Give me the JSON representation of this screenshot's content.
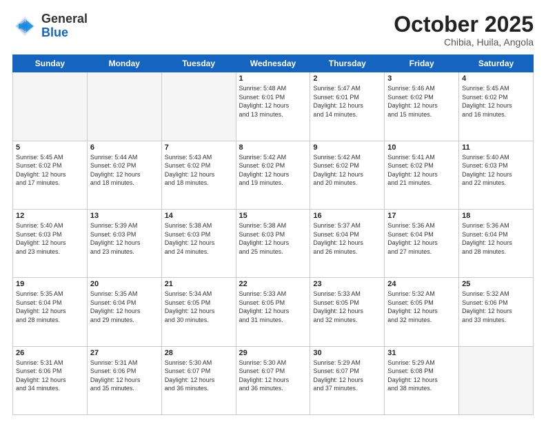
{
  "header": {
    "logo_line1": "General",
    "logo_line2": "Blue",
    "month": "October 2025",
    "location": "Chibia, Huila, Angola"
  },
  "weekdays": [
    "Sunday",
    "Monday",
    "Tuesday",
    "Wednesday",
    "Thursday",
    "Friday",
    "Saturday"
  ],
  "weeks": [
    [
      {
        "day": "",
        "info": "",
        "empty": true
      },
      {
        "day": "",
        "info": "",
        "empty": true
      },
      {
        "day": "",
        "info": "",
        "empty": true
      },
      {
        "day": "1",
        "info": "Sunrise: 5:48 AM\nSunset: 6:01 PM\nDaylight: 12 hours\nand 13 minutes."
      },
      {
        "day": "2",
        "info": "Sunrise: 5:47 AM\nSunset: 6:01 PM\nDaylight: 12 hours\nand 14 minutes."
      },
      {
        "day": "3",
        "info": "Sunrise: 5:46 AM\nSunset: 6:02 PM\nDaylight: 12 hours\nand 15 minutes."
      },
      {
        "day": "4",
        "info": "Sunrise: 5:45 AM\nSunset: 6:02 PM\nDaylight: 12 hours\nand 16 minutes."
      }
    ],
    [
      {
        "day": "5",
        "info": "Sunrise: 5:45 AM\nSunset: 6:02 PM\nDaylight: 12 hours\nand 17 minutes."
      },
      {
        "day": "6",
        "info": "Sunrise: 5:44 AM\nSunset: 6:02 PM\nDaylight: 12 hours\nand 18 minutes."
      },
      {
        "day": "7",
        "info": "Sunrise: 5:43 AM\nSunset: 6:02 PM\nDaylight: 12 hours\nand 18 minutes."
      },
      {
        "day": "8",
        "info": "Sunrise: 5:42 AM\nSunset: 6:02 PM\nDaylight: 12 hours\nand 19 minutes."
      },
      {
        "day": "9",
        "info": "Sunrise: 5:42 AM\nSunset: 6:02 PM\nDaylight: 12 hours\nand 20 minutes."
      },
      {
        "day": "10",
        "info": "Sunrise: 5:41 AM\nSunset: 6:02 PM\nDaylight: 12 hours\nand 21 minutes."
      },
      {
        "day": "11",
        "info": "Sunrise: 5:40 AM\nSunset: 6:03 PM\nDaylight: 12 hours\nand 22 minutes."
      }
    ],
    [
      {
        "day": "12",
        "info": "Sunrise: 5:40 AM\nSunset: 6:03 PM\nDaylight: 12 hours\nand 23 minutes."
      },
      {
        "day": "13",
        "info": "Sunrise: 5:39 AM\nSunset: 6:03 PM\nDaylight: 12 hours\nand 23 minutes."
      },
      {
        "day": "14",
        "info": "Sunrise: 5:38 AM\nSunset: 6:03 PM\nDaylight: 12 hours\nand 24 minutes."
      },
      {
        "day": "15",
        "info": "Sunrise: 5:38 AM\nSunset: 6:03 PM\nDaylight: 12 hours\nand 25 minutes."
      },
      {
        "day": "16",
        "info": "Sunrise: 5:37 AM\nSunset: 6:04 PM\nDaylight: 12 hours\nand 26 minutes."
      },
      {
        "day": "17",
        "info": "Sunrise: 5:36 AM\nSunset: 6:04 PM\nDaylight: 12 hours\nand 27 minutes."
      },
      {
        "day": "18",
        "info": "Sunrise: 5:36 AM\nSunset: 6:04 PM\nDaylight: 12 hours\nand 28 minutes."
      }
    ],
    [
      {
        "day": "19",
        "info": "Sunrise: 5:35 AM\nSunset: 6:04 PM\nDaylight: 12 hours\nand 28 minutes."
      },
      {
        "day": "20",
        "info": "Sunrise: 5:35 AM\nSunset: 6:04 PM\nDaylight: 12 hours\nand 29 minutes."
      },
      {
        "day": "21",
        "info": "Sunrise: 5:34 AM\nSunset: 6:05 PM\nDaylight: 12 hours\nand 30 minutes."
      },
      {
        "day": "22",
        "info": "Sunrise: 5:33 AM\nSunset: 6:05 PM\nDaylight: 12 hours\nand 31 minutes."
      },
      {
        "day": "23",
        "info": "Sunrise: 5:33 AM\nSunset: 6:05 PM\nDaylight: 12 hours\nand 32 minutes."
      },
      {
        "day": "24",
        "info": "Sunrise: 5:32 AM\nSunset: 6:05 PM\nDaylight: 12 hours\nand 32 minutes."
      },
      {
        "day": "25",
        "info": "Sunrise: 5:32 AM\nSunset: 6:06 PM\nDaylight: 12 hours\nand 33 minutes."
      }
    ],
    [
      {
        "day": "26",
        "info": "Sunrise: 5:31 AM\nSunset: 6:06 PM\nDaylight: 12 hours\nand 34 minutes."
      },
      {
        "day": "27",
        "info": "Sunrise: 5:31 AM\nSunset: 6:06 PM\nDaylight: 12 hours\nand 35 minutes."
      },
      {
        "day": "28",
        "info": "Sunrise: 5:30 AM\nSunset: 6:07 PM\nDaylight: 12 hours\nand 36 minutes."
      },
      {
        "day": "29",
        "info": "Sunrise: 5:30 AM\nSunset: 6:07 PM\nDaylight: 12 hours\nand 36 minutes."
      },
      {
        "day": "30",
        "info": "Sunrise: 5:29 AM\nSunset: 6:07 PM\nDaylight: 12 hours\nand 37 minutes."
      },
      {
        "day": "31",
        "info": "Sunrise: 5:29 AM\nSunset: 6:08 PM\nDaylight: 12 hours\nand 38 minutes."
      },
      {
        "day": "",
        "info": "",
        "empty": true
      }
    ]
  ]
}
